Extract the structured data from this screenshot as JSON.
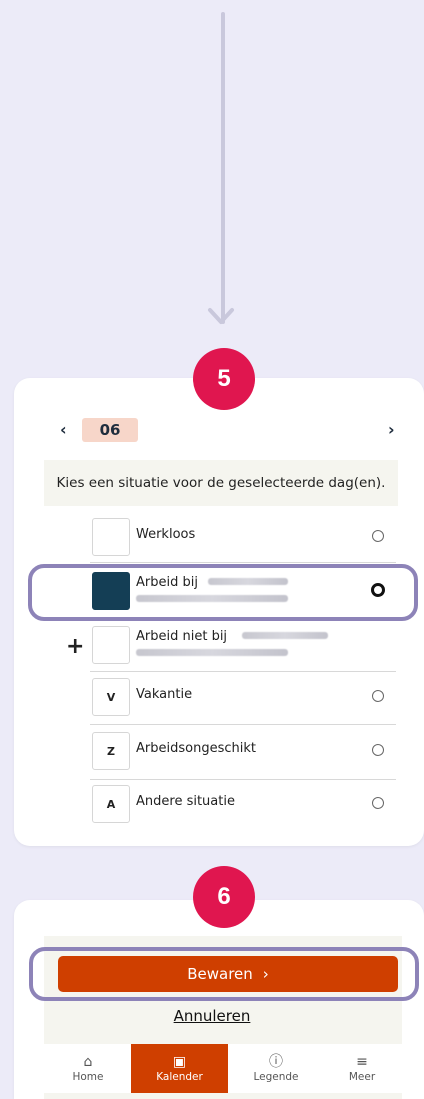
{
  "steps": {
    "step5": "5",
    "step6": "6"
  },
  "calendar": {
    "prev": "‹",
    "next": "›",
    "month": "06"
  },
  "prompt": "Kies een situatie voor de geselecteerde dag(en).",
  "options": [
    {
      "code": "",
      "label": "Werkloos",
      "selected": false
    },
    {
      "code": "",
      "label": "Arbeid bij",
      "selected": true,
      "color": "#143e55"
    },
    {
      "code": "",
      "label": "Arbeid niet bij",
      "selected": false,
      "add": "+"
    },
    {
      "code": "V",
      "label": "Vakantie",
      "selected": false
    },
    {
      "code": "Z",
      "label": "Arbeidsongeschikt",
      "selected": false
    },
    {
      "code": "A",
      "label": "Andere situatie",
      "selected": false
    }
  ],
  "actions": {
    "save": "Bewaren",
    "save_chevron": "›",
    "cancel": "Annuleren"
  },
  "tabs": [
    {
      "label": "Home",
      "icon": "home-icon",
      "glyph": "⌂"
    },
    {
      "label": "Kalender",
      "icon": "calendar-icon",
      "glyph": "▣",
      "active": true
    },
    {
      "label": "Legende",
      "icon": "info-icon",
      "glyph": "ⓘ"
    },
    {
      "label": "Meer",
      "icon": "menu-icon",
      "glyph": "≡"
    }
  ],
  "colors": {
    "badge": "#e0164f",
    "accent": "#cf3f00",
    "highlight": "#8d83b8",
    "chip": "#f7d6c9",
    "selected_box": "#143e55"
  }
}
